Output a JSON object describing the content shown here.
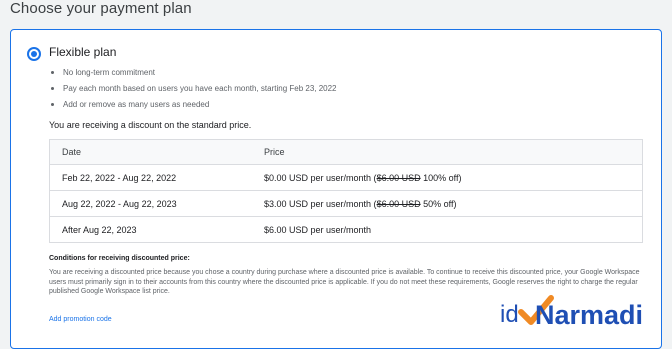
{
  "page": {
    "title": "Choose your payment plan"
  },
  "plan": {
    "name": "Flexible plan",
    "selected": true,
    "bullets": [
      "No long-term commitment",
      "Pay each month based on users you have each month, starting Feb 23, 2022",
      "Add or remove as many users as needed"
    ],
    "discount_note": "You are receiving a discount on the standard price."
  },
  "pricing_table": {
    "headers": {
      "date": "Date",
      "price": "Price"
    },
    "rows": [
      {
        "date": "Feb 22, 2022 - Aug 22, 2022",
        "price": "$0.00 USD per user/month (",
        "original": "$6.00 USD",
        "discount": " 100% off)"
      },
      {
        "date": "Aug 22, 2022 - Aug 22, 2023",
        "price": "$3.00 USD per user/month (",
        "original": "$6.00 USD",
        "discount": " 50% off)"
      },
      {
        "date": "After Aug 22, 2023",
        "price": "$6.00 USD per user/month",
        "original": "",
        "discount": ""
      }
    ]
  },
  "conditions": {
    "title": "Conditions for receiving discounted price:",
    "body": "You are receiving a discounted price because you chose a country during purchase where a discounted price is available. To continue to receive this discounted price, your Google Workspace users must primarily sign in to their accounts from this country where the discounted price is applicable. If you do not meet these requirements, Google reserves the right to charge the regular published Google Workspace list price."
  },
  "promo_link": "Add promotion code",
  "watermark": {
    "text_prefix": "id",
    "text_main": "Narmadi"
  },
  "colors": {
    "accent": "#1a73e8",
    "watermark_blue": "#1f4fb4",
    "watermark_orange": "#f08a24"
  }
}
